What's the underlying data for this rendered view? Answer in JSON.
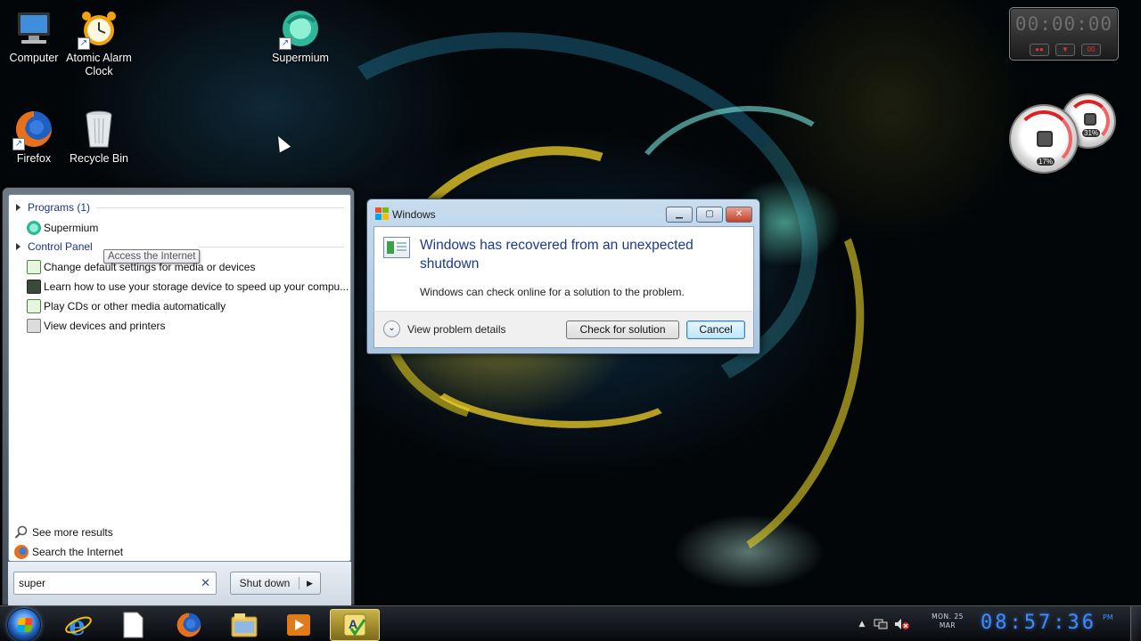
{
  "desktop": {
    "icons": [
      {
        "label": "Computer",
        "icon": "computer-icon"
      },
      {
        "label": "Atomic Alarm Clock",
        "icon": "alarm-clock-icon"
      },
      {
        "label": "Supermium",
        "icon": "supermium-icon"
      },
      {
        "label": "Firefox",
        "icon": "firefox-icon"
      },
      {
        "label": "Recycle Bin",
        "icon": "recycle-bin-icon"
      }
    ]
  },
  "gadgets": {
    "timer": {
      "display": "00:00:00"
    },
    "cpu_meter": {
      "cpu": "17%",
      "memory": "31%",
      "cpu_value": 17,
      "memory_value": 31
    }
  },
  "start_menu": {
    "groups": [
      {
        "label": "Programs (1)",
        "items": [
          "Supermium"
        ]
      },
      {
        "label": "Control Panel",
        "items": [
          "Change default settings for media or devices",
          "Learn how to use your storage device to speed up your compu...",
          "Play CDs or other media automatically",
          "View devices and printers"
        ]
      }
    ],
    "tooltip": "Access the Internet",
    "see_more": "See more results",
    "search_internet": "Search the Internet",
    "search_value": "super",
    "clear_glyph": "✕",
    "shutdown_label": "Shut down",
    "shutdown_arrow": "▶"
  },
  "dialog": {
    "title": "Windows",
    "heading": "Windows has recovered from an unexpected shutdown",
    "message": "Windows can check online for a solution to the problem.",
    "details_label": "View problem details",
    "check_button": "Check for solution",
    "cancel_button": "Cancel",
    "minimize_glyph": "▁",
    "maximize_glyph": "▢",
    "close_glyph": "✕",
    "chevron_glyph": "⌄"
  },
  "taskbar": {
    "apps": [
      "internet-explorer-icon",
      "document-icon",
      "firefox-icon",
      "windows-explorer-icon",
      "media-player-icon",
      "atomic-alarm-clock-icon"
    ],
    "active_app": "atomic-alarm-clock-icon",
    "tray": {
      "date_day": "MON. 25",
      "date_month": "MAR",
      "time": "08:57:36",
      "ampm": "PM"
    }
  },
  "colors": {
    "accent": "#1a3a8c",
    "clock": "#3d8bff",
    "close_red": "#c4412a"
  }
}
